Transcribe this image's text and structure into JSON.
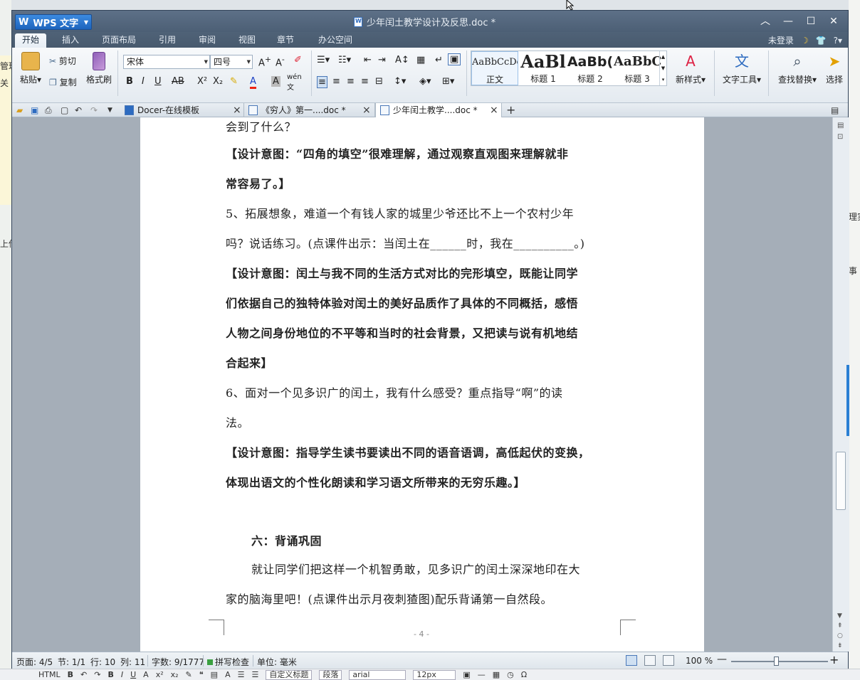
{
  "window": {
    "app_button": "WPS 文字",
    "title": "少年闰土教学设计及反思.doc *"
  },
  "menu": {
    "tabs": [
      "开始",
      "插入",
      "页面布局",
      "引用",
      "审阅",
      "视图",
      "章节",
      "办公空间"
    ],
    "login": "未登录"
  },
  "ribbon": {
    "paste": "粘贴",
    "cut": "剪切",
    "copy": "复制",
    "format_painter": "格式刷",
    "font_name": "宋体",
    "font_size": "四号",
    "styles": [
      {
        "preview": "AaBbCcDd",
        "label": "正文"
      },
      {
        "preview": "AaBl",
        "label": "标题 1"
      },
      {
        "preview": "AaBb(",
        "label": "标题 2"
      },
      {
        "preview": "AaBbC",
        "label": "标题 3"
      }
    ],
    "new_style": "新样式",
    "text_tools": "文字工具",
    "find_replace": "查找替换",
    "select": "选择"
  },
  "doc_tabs": [
    {
      "title": "Docer-在线模板"
    },
    {
      "title": "《穷人》第一....doc *"
    },
    {
      "title": "少年闰土教学....doc *"
    }
  ],
  "document": {
    "paragraphs": [
      {
        "text": "会到了什么？",
        "bold": false
      },
      {
        "text": "【设计意图：“四角的填空”很难理解，通过观察直观图来理解就非",
        "bold": true
      },
      {
        "text": "常容易了。】",
        "bold": true
      },
      {
        "text": "5、拓展想象，难道一个有钱人家的城里少爷还比不上一个农村少年",
        "bold": false
      },
      {
        "text": "吗？说话练习。(点课件出示：当闰土在______时，我在__________。)",
        "bold": false
      },
      {
        "text": "【设计意图：闰土与我不同的生活方式对比的完形填空，既能让同学",
        "bold": true
      },
      {
        "text": "们依据自己的独特体验对闰土的美好品质作了具体的不同概括，感悟",
        "bold": true
      },
      {
        "text": "人物之间身份地位的不平等和当时的社会背景，又把读与说有机地结",
        "bold": true
      },
      {
        "text": "合起来】",
        "bold": true
      },
      {
        "text": "6、面对一个见多识广的闰土，我有什么感受？重点指导“啊”的读",
        "bold": false
      },
      {
        "text": "法。",
        "bold": false
      },
      {
        "text": "【设计意图：指导学生读书要读出不同的语音语调，高低起伏的变换，",
        "bold": true
      },
      {
        "text": "体现出语文的个性化朗读和学习语文所带来的无穷乐趣。】",
        "bold": true
      },
      {
        "text": "六：背诵巩固",
        "bold": true
      },
      {
        "text": "就让同学们把这样一个机智勇敢，见多识广的闰土深深地印在大",
        "bold": false
      },
      {
        "text": "家的脑海里吧！(点课件出示月夜刺猹图)配乐背诵第一自然段。",
        "bold": false
      }
    ],
    "page_number": "- 4 -"
  },
  "status": {
    "page": "页面: 4/5",
    "section": "节: 1/1",
    "row": "行: 10",
    "col": "列: 11",
    "words": "字数: 9/1777",
    "spell": "拼写检查",
    "unit": "单位: 毫米",
    "zoom": "100 %",
    "zoom_level": 1.0
  },
  "background": {
    "left_fragments": [
      "管理",
      "关",
      "上传"
    ],
    "right_fragments": [
      "理实",
      "事"
    ],
    "bottom_labels": [
      "HTML",
      "自定义标题",
      "段落",
      "arial",
      "12px"
    ]
  }
}
